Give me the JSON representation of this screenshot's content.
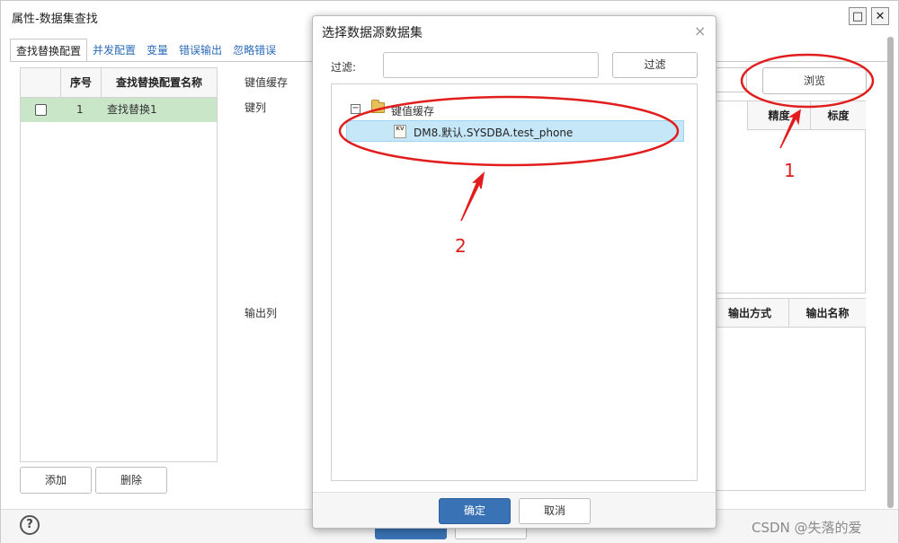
{
  "window": {
    "title": "属性-数据集查找",
    "maximize_glyph": "□",
    "close_glyph": "✕",
    "tabs": [
      {
        "label": "查找替换配置",
        "active": true
      },
      {
        "label": "并发配置",
        "active": false
      },
      {
        "label": "变量",
        "active": false
      },
      {
        "label": "错误输出",
        "active": false
      },
      {
        "label": "忽略错误",
        "active": false
      }
    ]
  },
  "left_grid": {
    "columns": [
      "序号",
      "查找替换配置名称"
    ],
    "rows": [
      {
        "index": "1",
        "name": "查找替换1",
        "checked": false
      }
    ]
  },
  "left_buttons": {
    "add": "添加",
    "delete": "删除"
  },
  "config": {
    "kv_cache_label": "键值缓存",
    "key_columns_label": "键列",
    "output_columns_label": "输出列",
    "browse_button": "浏览",
    "key_grid_columns": [
      "精度",
      "标度"
    ],
    "output_grid_columns": [
      "输出方式",
      "输出名称"
    ]
  },
  "footer": {
    "help_glyph": "?",
    "watermark": "CSDN @失落的爱"
  },
  "dialog": {
    "title": "选择数据源数据集",
    "close_glyph": "×",
    "filter_label": "过滤:",
    "filter_value": "",
    "filter_button": "过滤",
    "tree": {
      "toggle_glyph": "−",
      "root": {
        "label": "键值缓存",
        "icon": "folder-icon",
        "expanded": true
      },
      "children": [
        {
          "label": "DM8.默认.SYSDBA.test_phone",
          "icon": "kv-dataset-icon",
          "icon_text": "KV",
          "selected": true
        }
      ]
    },
    "ok_button": "确定",
    "cancel_button": "取消"
  },
  "annotations": {
    "color": "#e11d1d",
    "labels": [
      "1",
      "2"
    ]
  },
  "colors": {
    "primary_button": "#3a73b5",
    "selected_row": "#c9e6c9",
    "tree_selection": "#c6e7f8",
    "tab_link": "#2b6cb8"
  }
}
